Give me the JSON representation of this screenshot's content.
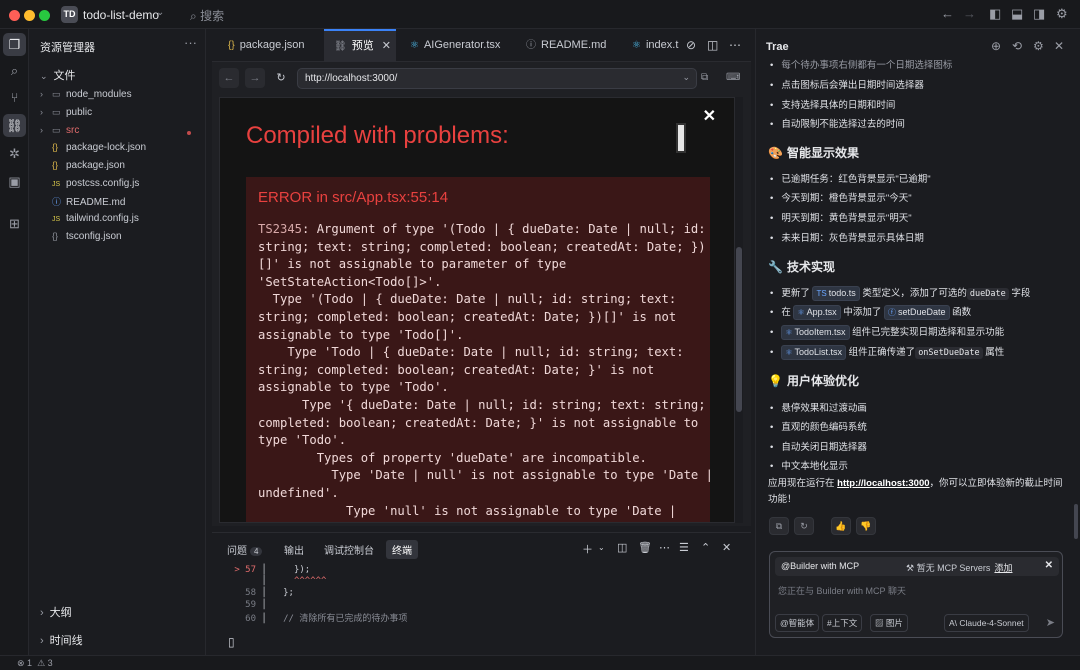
{
  "window": {
    "project_initials": "TD",
    "project_name": "todo-list-demo",
    "search_placeholder": "搜索"
  },
  "explorer": {
    "title": "资源管理器",
    "files_header": "文件",
    "items": [
      {
        "label": "node_modules",
        "type": "folder"
      },
      {
        "label": "public",
        "type": "folder"
      },
      {
        "label": "src",
        "type": "folder"
      },
      {
        "label": "package-lock.json",
        "type": "json"
      },
      {
        "label": "package.json",
        "type": "json"
      },
      {
        "label": "postcss.config.js",
        "type": "js"
      },
      {
        "label": "README.md",
        "type": "md"
      },
      {
        "label": "tailwind.config.js",
        "type": "js"
      },
      {
        "label": "tsconfig.json",
        "type": "json"
      }
    ],
    "outline": "大纲",
    "timeline": "时间线"
  },
  "editor": {
    "tabs": [
      {
        "label": "package.json",
        "icon": "{}"
      },
      {
        "label": "预览",
        "icon": "link"
      },
      {
        "label": "AIGenerator.tsx",
        "icon": "react"
      },
      {
        "label": "README.md",
        "icon": "info"
      },
      {
        "label": "index.t",
        "icon": "react"
      }
    ],
    "url": "http://localhost:3000/"
  },
  "overlay": {
    "title": "Compiled with problems:",
    "error_heading": "ERROR in src/App.tsx:55:14",
    "error_code": "TS2345",
    "error_body": ": Argument of type '(Todo | { dueDate: Date | null; id:\nstring; text: string; completed: boolean; createdAt: Date; })\n[]' is not assignable to parameter of type\n'SetStateAction<Todo[]>'.\n  Type '(Todo | { dueDate: Date | null; id: string; text:\nstring; completed: boolean; createdAt: Date; })[]' is not\nassignable to type 'Todo[]'.\n    Type 'Todo | { dueDate: Date | null; id: string; text:\nstring; completed: boolean; createdAt: Date; }' is not\nassignable to type 'Todo'.\n      Type '{ dueDate: Date | null; id: string; text: string;\ncompleted: boolean; createdAt: Date; }' is not assignable to\ntype 'Todo'.\n        Types of property 'dueDate' are incompatible.\n          Type 'Date | null' is not assignable to type 'Date |\nundefined'.\n            Type 'null' is not assignable to type 'Date |"
  },
  "terminal": {
    "tabs": {
      "problems": "问题",
      "problems_count": "4",
      "output": "输出",
      "debug": "调试控制台",
      "terminal": "终端"
    },
    "lines": [
      {
        "num": "> 57",
        "code": "    });",
        "err": false
      },
      {
        "num": "",
        "code": "    ^^^^^^",
        "err": true
      },
      {
        "num": "58",
        "code": "  };",
        "err": false
      },
      {
        "num": "59",
        "code": "",
        "err": false
      },
      {
        "num": "60",
        "code": "  // 清除所有已完成的待办事项",
        "err": false
      }
    ],
    "prompt": "▯"
  },
  "chat": {
    "title": "Trae",
    "partial_top": "每个待办事项右侧都有一个日期选择图标",
    "intro_bullets": [
      "点击图标后会弹出日期时间选择器",
      "支持选择具体的日期和时间",
      "自动限制不能选择过去的时间"
    ],
    "display_heading": "智能显示效果",
    "display_bullets": [
      "已逾期任务：红色背景显示\"已逾期\"",
      "今天到期：橙色背景显示\"今天\"",
      "明天到期：黄色背景显示\"明天\"",
      "未来日期：灰色背景显示具体日期"
    ],
    "tech_heading": "技术实现",
    "tech": {
      "b1_pre": "更新了",
      "b1_chip": "todo.ts",
      "b1_mid": "类型定义，添加了可选的",
      "b1_code": "dueDate",
      "b1_post": "字段",
      "b2_pre": "在",
      "b2_chip": "App.tsx",
      "b2_mid": "中添加了",
      "b2_code": "setDueDate",
      "b2_post": "函数",
      "b3_chip": "TodoItem.tsx",
      "b3_post": "组件已完整实现日期选择和显示功能",
      "b4_chip": "TodoList.tsx",
      "b4_mid": "组件正确传递了",
      "b4_code": "onSetDueDate",
      "b4_post": "属性"
    },
    "ux_heading": "用户体验优化",
    "ux_bullets": [
      "悬停效果和过渡动画",
      "直观的颜色编码系统",
      "自动关闭日期选择器",
      "中文本地化显示"
    ],
    "closing_pre": "应用现在运行在",
    "closing_link": "http://localhost:3000",
    "closing_post": "，你可以立即体验新的截止时间功能！",
    "input": {
      "builder": "@Builder with MCP",
      "mcp_status": "暂无 MCP Servers",
      "mcp_add": "添加",
      "placeholder": "您正在与 Builder with MCP 聊天",
      "btn_agent": "@智能体",
      "btn_context": "#上下文",
      "btn_image": "图片",
      "model": "Claude-4-Sonnet"
    }
  },
  "status": {
    "errors": "1",
    "warnings": "3"
  }
}
